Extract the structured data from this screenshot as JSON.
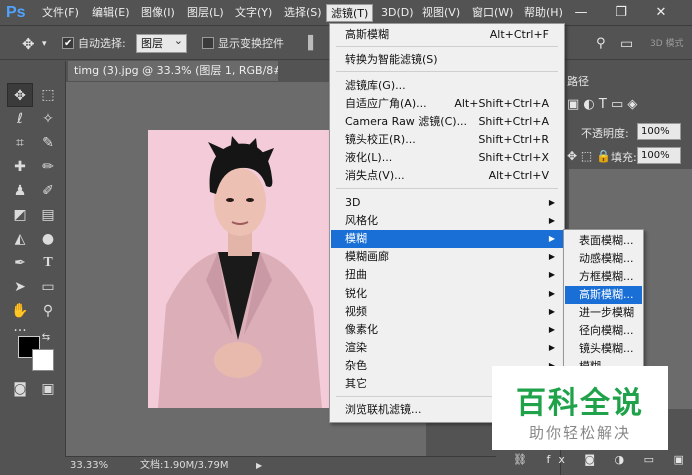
{
  "app": {
    "logo": "Ps"
  },
  "menubar": {
    "items": [
      "文件(F)",
      "编辑(E)",
      "图像(I)",
      "图层(L)",
      "文字(Y)",
      "选择(S)",
      "滤镜(T)",
      "3D(D)",
      "视图(V)",
      "窗口(W)",
      "帮助(H)"
    ],
    "active": "滤镜(T)",
    "controls": {
      "minimize": "—",
      "restore": "❐",
      "close": "✕"
    }
  },
  "options_bar": {
    "auto_select_label": "自动选择:",
    "auto_select_checked": true,
    "auto_select_value": "图层",
    "show_transform_label": "显示变换控件",
    "show_transform_checked": false,
    "mode_3d": "3D 模式"
  },
  "document": {
    "tab_title": "timg (3).jpg @ 33.3% (图层 1, RGB/8#) *",
    "tab_close": "×"
  },
  "statusbar": {
    "zoom": "33.33%",
    "doc_info": "文档:1.90M/3.79M",
    "arrow": "▶"
  },
  "panels": {
    "tab_label": "路径",
    "opacity_label": "不透明度:",
    "opacity_value": "100%",
    "fill_label": "填充:",
    "fill_value": "100%",
    "bottom_icons": [
      "link-icon",
      "fx-icon",
      "mask-icon",
      "adjustment-icon",
      "group-icon",
      "new-layer-icon",
      "trash-icon"
    ]
  },
  "filter_menu": {
    "items": [
      {
        "label": "高斯模糊",
        "shortcut": "Alt+Ctrl+F"
      },
      {
        "label": "转换为智能滤镜(S)",
        "shortcut": ""
      },
      {
        "label": "滤镜库(G)...",
        "shortcut": ""
      },
      {
        "label": "自适应广角(A)...",
        "shortcut": "Alt+Shift+Ctrl+A"
      },
      {
        "label": "Camera Raw 滤镜(C)...",
        "shortcut": "Shift+Ctrl+A"
      },
      {
        "label": "镜头校正(R)...",
        "shortcut": "Shift+Ctrl+R"
      },
      {
        "label": "液化(L)...",
        "shortcut": "Shift+Ctrl+X"
      },
      {
        "label": "消失点(V)...",
        "shortcut": "Alt+Ctrl+V"
      },
      {
        "label": "3D",
        "submenu": true
      },
      {
        "label": "风格化",
        "submenu": true
      },
      {
        "label": "模糊",
        "submenu": true,
        "highlighted": true
      },
      {
        "label": "模糊画廊",
        "submenu": true
      },
      {
        "label": "扭曲",
        "submenu": true
      },
      {
        "label": "锐化",
        "submenu": true
      },
      {
        "label": "视频",
        "submenu": true
      },
      {
        "label": "像素化",
        "submenu": true
      },
      {
        "label": "渲染",
        "submenu": true
      },
      {
        "label": "杂色",
        "submenu": true
      },
      {
        "label": "其它",
        "submenu": true
      },
      {
        "label": "浏览联机滤镜...",
        "shortcut": ""
      }
    ]
  },
  "blur_submenu": {
    "items": [
      "表面模糊...",
      "动感模糊...",
      "方框模糊...",
      "高斯模糊...",
      "进一步模糊",
      "径向模糊...",
      "镜头模糊...",
      "模糊"
    ],
    "highlighted_index": 3
  },
  "watermark": {
    "title": "百科全说",
    "subtitle": "助你轻松解决"
  },
  "colors": {
    "accent": "#1a6fd6",
    "brand_green": "#1fa24a",
    "ps_blue": "#4fa3ff"
  }
}
